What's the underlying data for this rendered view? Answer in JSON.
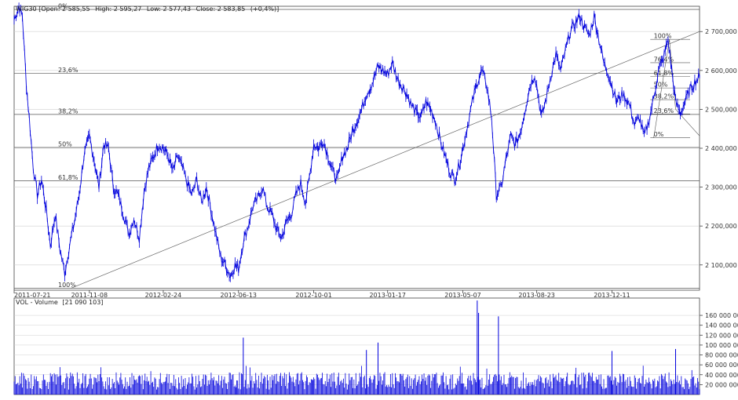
{
  "price_header": {
    "symbol": "WIG30",
    "open_label": "Open:",
    "open": "2 585,55",
    "high_label": "High:",
    "high": "2 595,27",
    "low_label": "Low:",
    "low": "2 577,43",
    "close_label": "Close:",
    "close": "2 583,85",
    "change": "(+0,4%)"
  },
  "volume_header": {
    "label": "VOL - Volume",
    "value": "[21 090 103]"
  },
  "colors": {
    "series": "#0000dd",
    "grid": "#d0d0d0",
    "axis": "#444444",
    "fib": "#555555",
    "trend": "#666666"
  },
  "chart_data": [
    {
      "type": "line",
      "title": "",
      "xlabel": "",
      "ylabel": "",
      "x_ticks": [
        "2011-07-21",
        "2011-11-08",
        "2012-02-24",
        "2012-06-13",
        "2012-10-01",
        "2013-01-17",
        "2013-05-07",
        "2013-08-23",
        "2013-12-11"
      ],
      "x_range": [
        "2011-07-21",
        "2014-04-18"
      ],
      "ylim": [
        2035,
        2765
      ],
      "y_ticks": [
        2100,
        2200,
        2300,
        2400,
        2500,
        2600,
        2700
      ],
      "y_tick_labels": [
        "2 100,000",
        "2 200,000",
        "2 300,000",
        "2 400,000",
        "2 500,000",
        "2 600,000",
        "2 700,000"
      ],
      "grid": "horizontal",
      "series": [
        {
          "points": [
            [
              "2011-07-21",
              2730
            ],
            [
              "2011-07-28",
              2765
            ],
            [
              "2011-08-02",
              2740
            ],
            [
              "2011-08-08",
              2560
            ],
            [
              "2011-08-12",
              2480
            ],
            [
              "2011-08-18",
              2350
            ],
            [
              "2011-08-24",
              2280
            ],
            [
              "2011-08-30",
              2320
            ],
            [
              "2011-09-06",
              2240
            ],
            [
              "2011-09-12",
              2150
            ],
            [
              "2011-09-19",
              2230
            ],
            [
              "2011-09-26",
              2140
            ],
            [
              "2011-10-03",
              2080
            ],
            [
              "2011-10-10",
              2150
            ],
            [
              "2011-10-17",
              2210
            ],
            [
              "2011-10-24",
              2280
            ],
            [
              "2011-10-31",
              2380
            ],
            [
              "2011-11-08",
              2430
            ],
            [
              "2011-11-15",
              2370
            ],
            [
              "2011-11-22",
              2300
            ],
            [
              "2011-11-29",
              2410
            ],
            [
              "2011-12-06",
              2400
            ],
            [
              "2011-12-13",
              2300
            ],
            [
              "2011-12-20",
              2280
            ],
            [
              "2011-12-28",
              2230
            ],
            [
              "2012-01-05",
              2180
            ],
            [
              "2012-01-12",
              2220
            ],
            [
              "2012-01-20",
              2170
            ],
            [
              "2012-01-27",
              2290
            ],
            [
              "2012-02-03",
              2350
            ],
            [
              "2012-02-10",
              2380
            ],
            [
              "2012-02-17",
              2410
            ],
            [
              "2012-02-24",
              2400
            ],
            [
              "2012-03-02",
              2380
            ],
            [
              "2012-03-09",
              2340
            ],
            [
              "2012-03-16",
              2380
            ],
            [
              "2012-03-23",
              2350
            ],
            [
              "2012-03-30",
              2310
            ],
            [
              "2012-04-06",
              2280
            ],
            [
              "2012-04-13",
              2320
            ],
            [
              "2012-04-20",
              2260
            ],
            [
              "2012-04-27",
              2300
            ],
            [
              "2012-05-04",
              2240
            ],
            [
              "2012-05-11",
              2180
            ],
            [
              "2012-05-18",
              2120
            ],
            [
              "2012-05-25",
              2100
            ],
            [
              "2012-06-01",
              2070
            ],
            [
              "2012-06-08",
              2100
            ],
            [
              "2012-06-13",
              2090
            ],
            [
              "2012-06-20",
              2160
            ],
            [
              "2012-06-27",
              2200
            ],
            [
              "2012-07-04",
              2250
            ],
            [
              "2012-07-11",
              2270
            ],
            [
              "2012-07-18",
              2300
            ],
            [
              "2012-07-25",
              2250
            ],
            [
              "2012-08-01",
              2230
            ],
            [
              "2012-08-08",
              2190
            ],
            [
              "2012-08-15",
              2170
            ],
            [
              "2012-08-22",
              2210
            ],
            [
              "2012-08-29",
              2230
            ],
            [
              "2012-09-05",
              2280
            ],
            [
              "2012-09-12",
              2310
            ],
            [
              "2012-09-19",
              2260
            ],
            [
              "2012-09-26",
              2340
            ],
            [
              "2012-10-01",
              2410
            ],
            [
              "2012-10-08",
              2400
            ],
            [
              "2012-10-15",
              2420
            ],
            [
              "2012-10-22",
              2380
            ],
            [
              "2012-10-29",
              2340
            ],
            [
              "2012-11-05",
              2320
            ],
            [
              "2012-11-12",
              2380
            ],
            [
              "2012-11-19",
              2400
            ],
            [
              "2012-11-26",
              2440
            ],
            [
              "2012-12-03",
              2470
            ],
            [
              "2012-12-10",
              2500
            ],
            [
              "2012-12-17",
              2540
            ],
            [
              "2012-12-24",
              2560
            ],
            [
              "2013-01-03",
              2610
            ],
            [
              "2013-01-10",
              2600
            ],
            [
              "2013-01-17",
              2590
            ],
            [
              "2013-01-24",
              2620
            ],
            [
              "2013-01-31",
              2580
            ],
            [
              "2013-02-07",
              2560
            ],
            [
              "2013-02-14",
              2540
            ],
            [
              "2013-02-21",
              2510
            ],
            [
              "2013-02-28",
              2490
            ],
            [
              "2013-03-07",
              2480
            ],
            [
              "2013-03-14",
              2520
            ],
            [
              "2013-03-21",
              2500
            ],
            [
              "2013-03-28",
              2470
            ],
            [
              "2013-04-04",
              2420
            ],
            [
              "2013-04-11",
              2380
            ],
            [
              "2013-04-18",
              2340
            ],
            [
              "2013-04-25",
              2320
            ],
            [
              "2013-05-02",
              2360
            ],
            [
              "2013-05-07",
              2400
            ],
            [
              "2013-05-14",
              2460
            ],
            [
              "2013-05-21",
              2520
            ],
            [
              "2013-05-28",
              2570
            ],
            [
              "2013-06-04",
              2600
            ],
            [
              "2013-06-11",
              2560
            ],
            [
              "2013-06-18",
              2480
            ],
            [
              "2013-06-25",
              2280
            ],
            [
              "2013-07-02",
              2300
            ],
            [
              "2013-07-09",
              2370
            ],
            [
              "2013-07-16",
              2430
            ],
            [
              "2013-07-23",
              2410
            ],
            [
              "2013-07-30",
              2440
            ],
            [
              "2013-08-06",
              2500
            ],
            [
              "2013-08-13",
              2560
            ],
            [
              "2013-08-20",
              2590
            ],
            [
              "2013-08-23",
              2560
            ],
            [
              "2013-08-30",
              2480
            ],
            [
              "2013-09-06",
              2530
            ],
            [
              "2013-09-13",
              2590
            ],
            [
              "2013-09-20",
              2640
            ],
            [
              "2013-09-27",
              2600
            ],
            [
              "2013-10-04",
              2650
            ],
            [
              "2013-10-11",
              2700
            ],
            [
              "2013-10-18",
              2720
            ],
            [
              "2013-10-25",
              2740
            ],
            [
              "2013-11-01",
              2710
            ],
            [
              "2013-11-08",
              2690
            ],
            [
              "2013-11-15",
              2740
            ],
            [
              "2013-11-22",
              2680
            ],
            [
              "2013-11-29",
              2620
            ],
            [
              "2013-12-06",
              2590
            ],
            [
              "2013-12-11",
              2560
            ],
            [
              "2013-12-18",
              2520
            ],
            [
              "2013-12-27",
              2540
            ],
            [
              "2014-01-06",
              2510
            ],
            [
              "2014-01-13",
              2460
            ],
            [
              "2014-01-20",
              2480
            ],
            [
              "2014-01-27",
              2430
            ],
            [
              "2014-02-03",
              2470
            ],
            [
              "2014-02-10",
              2530
            ],
            [
              "2014-02-17",
              2600
            ],
            [
              "2014-02-24",
              2630
            ],
            [
              "2014-03-03",
              2680
            ],
            [
              "2014-03-07",
              2620
            ],
            [
              "2014-03-14",
              2520
            ],
            [
              "2014-03-21",
              2490
            ],
            [
              "2014-03-28",
              2520
            ],
            [
              "2014-04-04",
              2550
            ],
            [
              "2014-04-11",
              2570
            ],
            [
              "2014-04-18",
              2584
            ]
          ]
        }
      ],
      "trendline": [
        [
          "2011-10-12",
          2040
        ],
        [
          "2014-04-18",
          2700
        ]
      ],
      "fib_levels": [
        {
          "label": "0%",
          "value": 2757
        },
        {
          "label": "23,6%",
          "value": 2593
        },
        {
          "label": "38,2%",
          "value": 2487
        },
        {
          "label": "50%",
          "value": 2402
        },
        {
          "label": "61,8%",
          "value": 2316
        },
        {
          "label": "100%",
          "value": 2040
        }
      ],
      "fib_levels_2": [
        {
          "label": "100%",
          "value": 2680
        },
        {
          "label": "76,4%",
          "value": 2620
        },
        {
          "label": "61,8%",
          "value": 2585
        },
        {
          "label": "50%",
          "value": 2555
        },
        {
          "label": "38,2%",
          "value": 2525
        },
        {
          "label": "23,6%",
          "value": 2488
        },
        {
          "label": "0%",
          "value": 2427
        }
      ]
    },
    {
      "type": "bar",
      "title": "",
      "ylim": [
        0,
        195000000
      ],
      "y_ticks": [
        20000000,
        40000000,
        60000000,
        80000000,
        100000000,
        120000000,
        140000000,
        160000000
      ],
      "y_tick_labels": [
        "20 000 000",
        "40 000 000",
        "60 000 000",
        "80 000 000",
        "100 000 000",
        "120 000 000",
        "140 000 000",
        "160 000 000"
      ],
      "spikes": [
        [
          "2013-05-28",
          190000000
        ],
        [
          "2013-05-30",
          165000000
        ],
        [
          "2013-06-28",
          158000000
        ],
        [
          "2012-06-20",
          115000000
        ],
        [
          "2013-01-03",
          105000000
        ],
        [
          "2012-12-17",
          90000000
        ],
        [
          "2013-12-11",
          88000000
        ],
        [
          "2014-03-14",
          92000000
        ]
      ],
      "base_volume_range": [
        10000000,
        45000000
      ]
    }
  ]
}
